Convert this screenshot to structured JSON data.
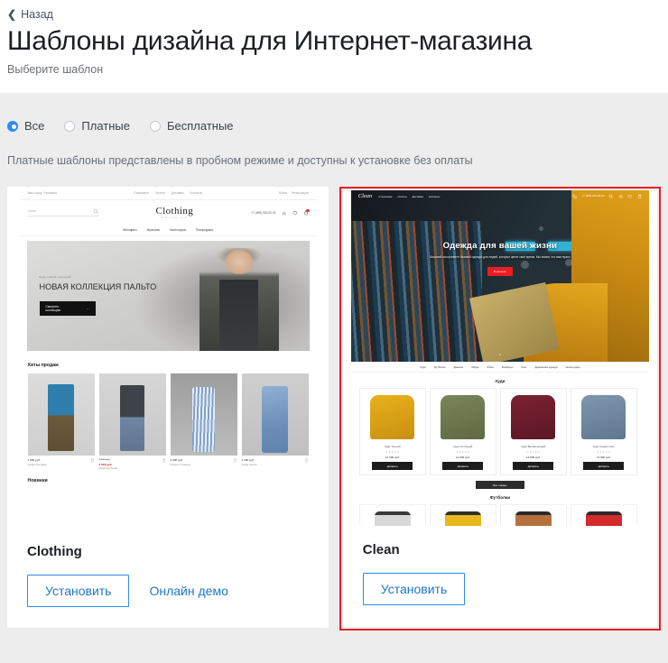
{
  "header": {
    "back_label": "Назад",
    "back_icon": "chevron-left-icon",
    "title": "Шаблоны дизайна для Интернет-магазина",
    "subtitle": "Выберите шаблон"
  },
  "filter": {
    "options": [
      {
        "label": "Все",
        "selected": true
      },
      {
        "label": "Платные",
        "selected": false
      },
      {
        "label": "Бесплатные",
        "selected": false
      }
    ],
    "note": "Платные шаблоны представлены в пробном режиме и доступны к установке без оплаты"
  },
  "colors": {
    "accent": "#2176c7",
    "radio_checked": "#2d8cf0",
    "highlight_border": "#ed1c24",
    "page_bg": "#ededed",
    "header_bg": "#ffffff"
  },
  "templates": [
    {
      "name": "Clothing",
      "install_label": "Установить",
      "demo_label": "Онлайн демо",
      "highlighted": false,
      "preview": {
        "topbar": {
          "city": "Ваш город: Ульяновск",
          "links": [
            "О магазине",
            "Оплата",
            "Доставка",
            "Контакты"
          ],
          "account": [
            "Войти",
            "Регистрация"
          ]
        },
        "search_placeholder": "Поиск",
        "search_icon": "search-icon",
        "logo": "Clothing",
        "logo_sub": "BEST FOR LOOK",
        "phone": "+7 (495) 000-00-00",
        "icons": [
          "compare-icon",
          "heart-icon",
          "cart-icon"
        ],
        "cart_badge": "1",
        "nav": [
          "Женщины",
          "Мужчины",
          "Аксессуары",
          "Распродажа"
        ],
        "hero": {
          "kicker": "Будь самой стильной!",
          "title": "НОВАЯ КОЛЛЕКЦИЯ ПАЛЬТО",
          "cta": "Смотреть коллекцию",
          "cta_icon": "arrow-right-icon"
        },
        "section_title": "Хиты продаж",
        "section_title_next": "Новинки",
        "products": [
          {
            "price": "1 990 руб.",
            "old_price": "",
            "name": "Синяя толстовка",
            "sale": false
          },
          {
            "price": "2 516 руб.",
            "old_price": "4 490 руб.",
            "name": "Серая футболка",
            "sale": true
          },
          {
            "price": "4 990 руб.",
            "name": "Платье с печатью",
            "sale": false
          },
          {
            "price": "4 990 руб.",
            "name": "Синее платье",
            "sale": false
          }
        ]
      }
    },
    {
      "name": "Clean",
      "install_label": "Установить",
      "demo_label": "",
      "highlighted": true,
      "preview": {
        "logo": "Clean",
        "nav": [
          "О магазине",
          "Оплата",
          "Доставка",
          "Контакты"
        ],
        "phone": "+7 (495) 000-00-00",
        "phone_icon": "phone-icon",
        "icons": [
          "search-icon",
          "user-icon",
          "heart-icon",
          "cart-icon"
        ],
        "hero": {
          "title": "Одежда для вашей жизни",
          "subtitle": "Широкий ассортимент базовой одежды для людей, которые ценят своё время. Мы знаем, что вам нужно",
          "cta": "В каталог",
          "scroll_icon": "chevron-down-icon"
        },
        "catnav": [
          "Худи",
          "Футболки",
          "Джинсы",
          "Обувь",
          "Юбки",
          "Бомберы",
          "Лонг",
          "Домашняя одежда",
          "Аксессуары"
        ],
        "section_title": "Худи",
        "section_title_2": "Футболки",
        "all_button": "Все товары",
        "products": [
          {
            "name": "Худи 'Тёплый'",
            "stars": "★★★★★",
            "price": "12 900 руб.",
            "add": "Добавить"
          },
          {
            "name": "Худи 'Отличный'",
            "stars": "★★★★★",
            "price": "12 900 руб.",
            "add": "Добавить"
          },
          {
            "name": "Худи 'Великолепный'",
            "stars": "★★★★★",
            "price": "13 900 руб.",
            "add": "Добавить"
          },
          {
            "name": "Худи 'Синий стиль'",
            "stars": "★★★★★",
            "price": "11 900 руб.",
            "add": "Добавить"
          }
        ]
      }
    }
  ]
}
